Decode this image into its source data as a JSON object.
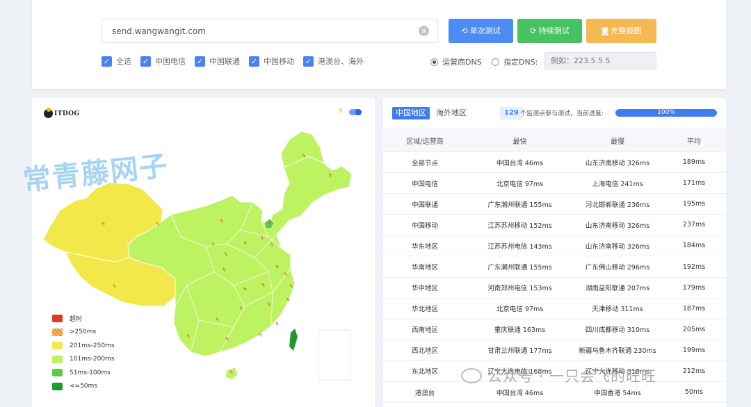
{
  "search": {
    "value": "send.wangwangit.com"
  },
  "buttons": {
    "single": "单次测试",
    "continuous": "持续测试",
    "screenshot": "完整截图"
  },
  "isp_filters": [
    {
      "label": "全选",
      "checked": true
    },
    {
      "label": "中国电信",
      "checked": true
    },
    {
      "label": "中国联通",
      "checked": true
    },
    {
      "label": "中国移动",
      "checked": true
    },
    {
      "label": "港澳台、海外",
      "checked": true
    }
  ],
  "dns": {
    "isp_dns_label": "运营商DNS",
    "custom_dns_label": "指定DNS:",
    "custom_placeholder": "例如：223.5.5.5",
    "selected": "isp"
  },
  "map": {
    "logo_text": "ITDOG",
    "legend": [
      {
        "label": "超时",
        "color": "#e03b1e"
      },
      {
        "label": ">250ms",
        "color": "#f59f3c"
      },
      {
        "label": "201ms-250ms",
        "color": "#f3e84a"
      },
      {
        "label": "101ms-200ms",
        "color": "#bdf261"
      },
      {
        "label": "51ms-100ms",
        "color": "#62c64a"
      },
      {
        "label": "<=50ms",
        "color": "#1e9a2e"
      }
    ],
    "colors": {
      "west": "#f3e84a",
      "main": "#bdf261",
      "beijing": "#62c64a",
      "bolt": "#e03b1e"
    }
  },
  "watermark": "常青藤网子",
  "results": {
    "tabs": [
      "中国地区",
      "海外地区"
    ],
    "active_tab": 0,
    "node_count": "129",
    "count_text": "个监测点参与测试，当前进度:",
    "progress": 100,
    "progress_label": "100%",
    "columns": [
      "区域/运营商",
      "最快",
      "最慢",
      "平均"
    ],
    "rows": [
      [
        "全部节点",
        "中国台湾 46ms",
        "山东济南移动 326ms",
        "189ms"
      ],
      [
        "中国电信",
        "北京电信 97ms",
        "上海电信 241ms",
        "171ms"
      ],
      [
        "中国联通",
        "广东潮州联通 155ms",
        "河北邯郸联通 236ms",
        "195ms"
      ],
      [
        "中国移动",
        "江苏苏州移动 152ms",
        "山东济南移动 326ms",
        "237ms"
      ],
      [
        "华东地区",
        "江苏苏州电信 143ms",
        "山东济南移动 326ms",
        "184ms"
      ],
      [
        "华南地区",
        "广东潮州联通 155ms",
        "广东佛山移动 296ms",
        "192ms"
      ],
      [
        "华中地区",
        "河南郑州电信 153ms",
        "湖南益阳联通 207ms",
        "179ms"
      ],
      [
        "华北地区",
        "北京电信 97ms",
        "天津移动 311ms",
        "187ms"
      ],
      [
        "西南地区",
        "重庆联通 163ms",
        "四川成都移动 310ms",
        "205ms"
      ],
      [
        "西北地区",
        "甘肃兰州联通 177ms",
        "新疆乌鲁木齐联通 230ms",
        "199ms"
      ],
      [
        "东北地区",
        "辽宁大连电信 168ms",
        "辽宁大连移动 318ms",
        "212ms"
      ],
      [
        "港澳台",
        "中国台湾 46ms",
        "中国香港 54ms",
        "50ms"
      ]
    ]
  },
  "wechat_watermark": "公众号 · 一只会飞的旺旺"
}
